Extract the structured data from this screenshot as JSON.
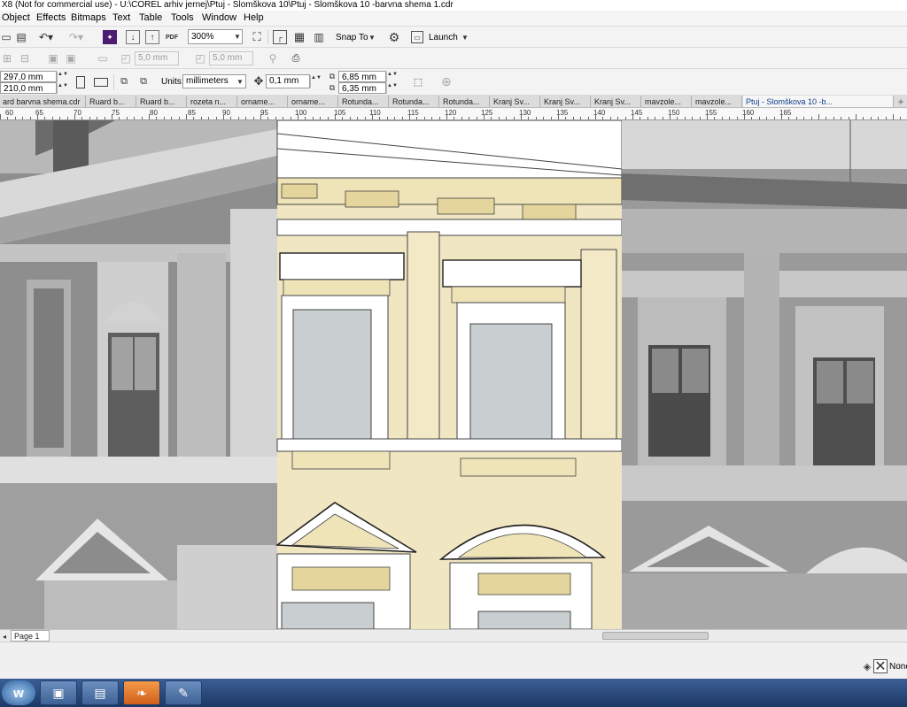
{
  "window": {
    "title": "X8 (Not for commercial use) - U:\\COREL arhiv jernej\\Ptuj - Slomškova 10\\Ptuj - Slomškova 10 -barvna shema 1.cdr"
  },
  "menu": [
    "Object",
    "Effects",
    "Bitmaps",
    "Text",
    "Table",
    "Tools",
    "Window",
    "Help"
  ],
  "toolbar": {
    "zoom": "300%",
    "snap_label": "Snap To",
    "launch_label": "Launch"
  },
  "propbar": {
    "width_disabled": "5,0 mm",
    "height_disabled": "5,0 mm",
    "page_width": "297,0 mm",
    "page_height": "210,0 mm",
    "units_label": "Units:",
    "units": "millimeters",
    "nudge": "0,1 mm",
    "dup_x": "6,85 mm",
    "dup_y": "6,35 mm"
  },
  "tabs": [
    "ard barvna shema.cdr",
    "Ruard b...",
    "Ruard b...",
    "rozeta n...",
    "orname...",
    "orname...",
    "Rotunda...",
    "Rotunda...",
    "Rotunda...",
    "Kranj Sv...",
    "Kranj Sv...",
    "Kranj Sv...",
    "mavzole...",
    "mavzole...",
    "Ptuj - Slomškova 10 -b..."
  ],
  "ruler": [
    "60",
    "65",
    "70",
    "75",
    "80",
    "85",
    "90",
    "95",
    "100",
    "105",
    "110",
    "115",
    "120",
    "125",
    "130",
    "135",
    "140",
    "145",
    "150",
    "155",
    "160",
    "165"
  ],
  "pagebar": {
    "page_tab": "Page 1"
  },
  "status": {
    "fill_none": "None"
  },
  "colors": {
    "facade_cream": "#f0e6c2",
    "window_glass": "#c9ced1",
    "photo_gray": "#9a9a9a"
  },
  "icons": [
    "undo-icon",
    "redo-icon",
    "import-icon",
    "export-icon",
    "pdf-icon",
    "fullscreen-icon",
    "snap-icon",
    "gear-icon",
    "launch-icon",
    "windows-start-icon",
    "media-icon",
    "folder-icon",
    "corel-icon",
    "paint-icon"
  ]
}
